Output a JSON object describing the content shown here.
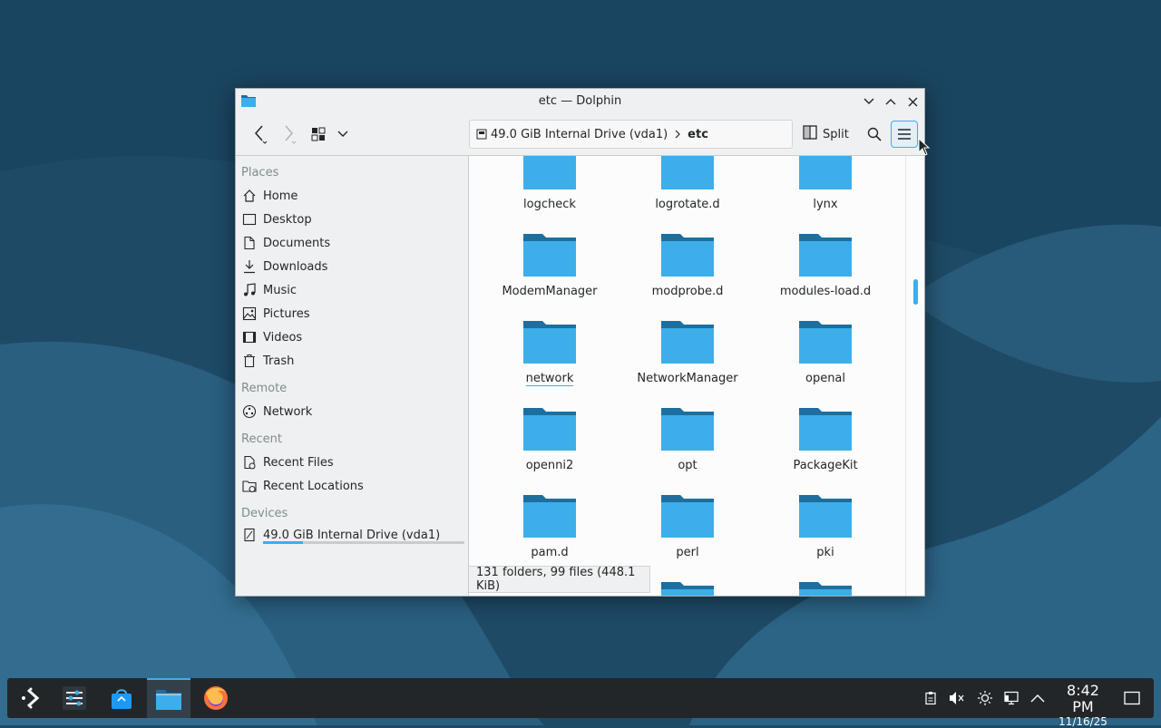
{
  "window": {
    "title": "etc — Dolphin",
    "toolbar": {
      "split_label": "Split"
    },
    "breadcrumb": {
      "drive": "49.0 GiB Internal Drive (vda1)",
      "current": "etc"
    }
  },
  "sidebar": {
    "sections": {
      "places": "Places",
      "remote": "Remote",
      "recent": "Recent",
      "devices": "Devices"
    },
    "places": [
      {
        "label": "Home",
        "icon": "home-icon"
      },
      {
        "label": "Desktop",
        "icon": "desktop-icon"
      },
      {
        "label": "Documents",
        "icon": "documents-icon"
      },
      {
        "label": "Downloads",
        "icon": "downloads-icon"
      },
      {
        "label": "Music",
        "icon": "music-icon"
      },
      {
        "label": "Pictures",
        "icon": "pictures-icon"
      },
      {
        "label": "Videos",
        "icon": "videos-icon"
      },
      {
        "label": "Trash",
        "icon": "trash-icon"
      }
    ],
    "remote": [
      {
        "label": "Network",
        "icon": "network-icon"
      }
    ],
    "recent": [
      {
        "label": "Recent Files",
        "icon": "recent-files-icon"
      },
      {
        "label": "Recent Locations",
        "icon": "recent-locations-icon"
      }
    ],
    "devices": [
      {
        "label": "49.0 GiB Internal Drive (vda1)",
        "icon": "drive-icon",
        "usage_fraction": 0.2
      }
    ]
  },
  "files": [
    {
      "name": "logcheck"
    },
    {
      "name": "logrotate.d"
    },
    {
      "name": "lynx"
    },
    {
      "name": "ModemManager"
    },
    {
      "name": "modprobe.d"
    },
    {
      "name": "modules-load.d"
    },
    {
      "name": "network"
    },
    {
      "name": "NetworkManager"
    },
    {
      "name": "openal"
    },
    {
      "name": "openni2"
    },
    {
      "name": "opt"
    },
    {
      "name": "PackageKit"
    },
    {
      "name": "pam.d"
    },
    {
      "name": "perl"
    },
    {
      "name": "pki"
    }
  ],
  "statusbar": {
    "text": "131 folders, 99 files (448.1 KiB)"
  },
  "colors": {
    "accent": "#3daee9",
    "folder_body": "#3daee9",
    "folder_tab": "#1d6fa0"
  },
  "taskbar": {
    "apps": [
      {
        "name": "application-launcher-icon"
      },
      {
        "name": "system-settings-icon"
      },
      {
        "name": "discover-icon"
      },
      {
        "name": "dolphin-icon",
        "active": true
      },
      {
        "name": "firefox-icon"
      }
    ],
    "tray": [
      "clipboard-icon",
      "volume-muted-icon",
      "brightness-icon",
      "network-wired-icon",
      "tray-expand-icon"
    ],
    "clock": {
      "time": "8:42 PM",
      "date": "11/16/25"
    }
  }
}
